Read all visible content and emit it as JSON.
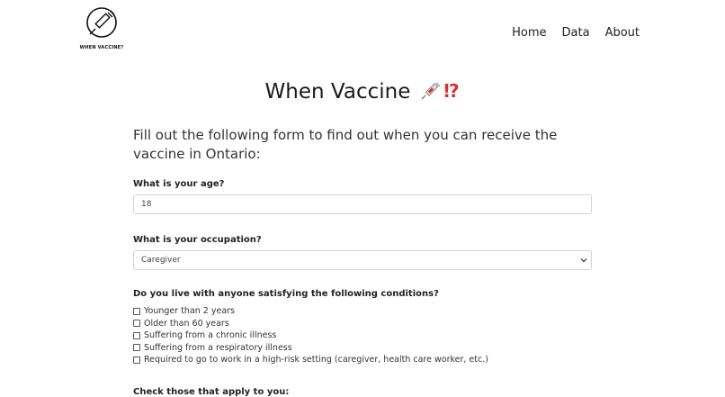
{
  "nav": {
    "logo_text": "WHEN VACCINE?",
    "links": [
      "Home",
      "Data",
      "About"
    ]
  },
  "page": {
    "title": "When Vaccine",
    "intro": "Fill out the following form to find out when you can receive the vaccine in Ontario:"
  },
  "form": {
    "age": {
      "label": "What is your age?",
      "value": "18"
    },
    "occupation": {
      "label": "What is your occupation?",
      "selected": "Caregiver"
    },
    "household": {
      "label": "Do you live with anyone satisfying the following conditions?",
      "options": [
        "Younger than 2 years",
        "Older than 60 years",
        "Suffering from a chronic illness",
        "Suffering from a respiratory illness",
        "Required to go to work in a high-risk setting (caregiver, health care worker, etc.)"
      ]
    },
    "self": {
      "label": "Check those that apply to you:"
    }
  },
  "icons": {
    "logo": "syringe-circle-icon",
    "title_emoji": "syringe-exclamation-icon",
    "dropdown": "chevron-down-icon"
  }
}
